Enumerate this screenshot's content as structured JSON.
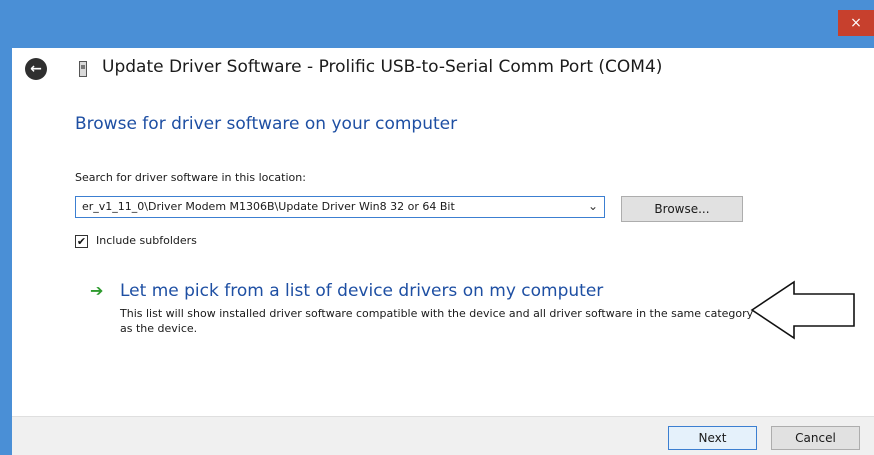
{
  "window": {
    "title": "Update Driver Software - Prolific USB-to-Serial Comm Port (COM4)",
    "close_icon": "×"
  },
  "header": {
    "back_icon": "←"
  },
  "main": {
    "heading": "Browse for driver software on your computer",
    "search_label": "Search for driver software in this location:",
    "path_value": "er_v1_11_0\\Driver Modem M1306B\\Update Driver Win8 32 or 64 Bit",
    "dropdown_icon": "⌄",
    "browse_label": "Browse...",
    "include_subfolders": {
      "label": "Include subfolders",
      "checked": true,
      "check_glyph": "✔"
    },
    "pick_option": {
      "arrow_icon": "➔",
      "title": "Let me pick from a list of device drivers on my computer",
      "description": "This list will show installed driver software compatible with the device and all driver software in the same category as the device."
    }
  },
  "footer": {
    "next_label": "Next",
    "cancel_label": "Cancel"
  },
  "colors": {
    "titlebar": "#4a8fd6",
    "close": "#c7402d",
    "heading": "#1e4fa3",
    "green_arrow": "#2e9b2e"
  }
}
